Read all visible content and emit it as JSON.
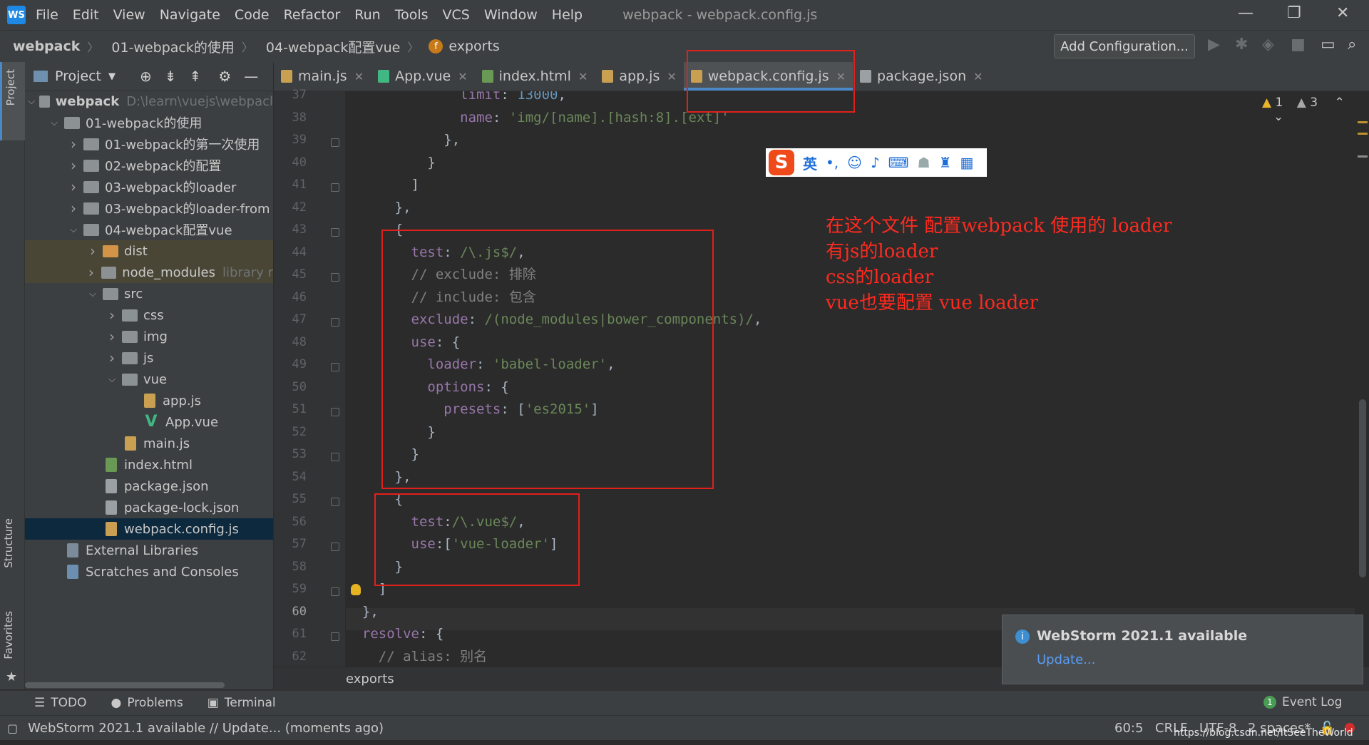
{
  "app": {
    "title": "webpack - webpack.config.js",
    "logo": "WS",
    "menu": [
      "File",
      "Edit",
      "View",
      "Navigate",
      "Code",
      "Refactor",
      "Run",
      "Tools",
      "VCS",
      "Window",
      "Help"
    ]
  },
  "navbar": {
    "crumbs": [
      "webpack",
      "01-webpack的使用",
      "04-webpack配置vue"
    ],
    "symbol_badge": "f",
    "symbol": "exports",
    "add_configuration": "Add Configuration..."
  },
  "left_strip": {
    "project": "Project",
    "structure": "Structure",
    "favorites": "Favorites"
  },
  "project_panel": {
    "header": "Project",
    "tree": [
      {
        "label": "webpack",
        "extra": "D:\\learn\\vuejs\\webpacl",
        "depth": 0,
        "type": "folder",
        "arrow": "open",
        "bold": true
      },
      {
        "label": "01-webpack的使用",
        "depth": 1,
        "type": "folder",
        "arrow": "open"
      },
      {
        "label": "01-webpack的第一次使用",
        "depth": 2,
        "type": "folder",
        "arrow": "closed"
      },
      {
        "label": "02-webpack的配置",
        "depth": 2,
        "type": "folder",
        "arrow": "closed"
      },
      {
        "label": "03-webpack的loader",
        "depth": 2,
        "type": "folder",
        "arrow": "closed"
      },
      {
        "label": "03-webpack的loader-from",
        "depth": 2,
        "type": "folder",
        "arrow": "closed"
      },
      {
        "label": "04-webpack配置vue",
        "depth": 2,
        "type": "folder",
        "arrow": "open"
      },
      {
        "label": "dist",
        "depth": 3,
        "type": "folder-orange",
        "arrow": "closed",
        "excluded": true
      },
      {
        "label": "node_modules",
        "extra": "library r",
        "depth": 3,
        "type": "folder",
        "arrow": "closed",
        "excluded": true
      },
      {
        "label": "src",
        "depth": 3,
        "type": "folder",
        "arrow": "open"
      },
      {
        "label": "css",
        "depth": 4,
        "type": "folder",
        "arrow": "closed"
      },
      {
        "label": "img",
        "depth": 4,
        "type": "folder",
        "arrow": "closed"
      },
      {
        "label": "js",
        "depth": 4,
        "type": "folder",
        "arrow": "closed"
      },
      {
        "label": "vue",
        "depth": 4,
        "type": "folder",
        "arrow": "open"
      },
      {
        "label": "app.js",
        "depth": 5,
        "type": "js"
      },
      {
        "label": "App.vue",
        "depth": 5,
        "type": "vue"
      },
      {
        "label": "main.js",
        "depth": 4,
        "type": "js"
      },
      {
        "label": "index.html",
        "depth": 3,
        "type": "html"
      },
      {
        "label": "package.json",
        "depth": 3,
        "type": "json"
      },
      {
        "label": "package-lock.json",
        "depth": 3,
        "type": "json"
      },
      {
        "label": "webpack.config.js",
        "depth": 3,
        "type": "js",
        "selected": true
      },
      {
        "label": "External Libraries",
        "depth": 1,
        "type": "lib"
      },
      {
        "label": "Scratches and Consoles",
        "depth": 1,
        "type": "scratch"
      }
    ]
  },
  "tabs": [
    {
      "label": "main.js",
      "icon": "js"
    },
    {
      "label": "App.vue",
      "icon": "vue"
    },
    {
      "label": "index.html",
      "icon": "html"
    },
    {
      "label": "app.js",
      "icon": "js"
    },
    {
      "label": "webpack.config.js",
      "icon": "js",
      "active": true
    },
    {
      "label": "package.json",
      "icon": "json"
    }
  ],
  "editor": {
    "line_numbers": [
      "37",
      "38",
      "39",
      "40",
      "41",
      "42",
      "43",
      "44",
      "45",
      "46",
      "47",
      "48",
      "49",
      "50",
      "51",
      "52",
      "53",
      "54",
      "55",
      "56",
      "57",
      "58",
      "59",
      "60",
      "61",
      "62"
    ],
    "current_line": "60",
    "warnings_a": "1",
    "warnings_b": "3",
    "breadcrumb": "exports",
    "lines": [
      [
        {
          "t": "              "
        },
        {
          "t": "limit",
          "c": "p"
        },
        {
          "t": ": "
        },
        {
          "t": "13000",
          "c": "n"
        },
        {
          "t": ","
        }
      ],
      [
        {
          "t": "              "
        },
        {
          "t": "name",
          "c": "p"
        },
        {
          "t": ": "
        },
        {
          "t": "'img/[name].[hash:8].[ext]'",
          "c": "s"
        }
      ],
      [
        {
          "t": "            },"
        }
      ],
      [
        {
          "t": "          }"
        }
      ],
      [
        {
          "t": "        ]"
        }
      ],
      [
        {
          "t": "      },"
        }
      ],
      [
        {
          "t": "      {"
        }
      ],
      [
        {
          "t": "        "
        },
        {
          "t": "test",
          "c": "p"
        },
        {
          "t": ": "
        },
        {
          "t": "/\\.js$/",
          "c": "s"
        },
        {
          "t": ","
        }
      ],
      [
        {
          "t": "        // exclude: 排除",
          "c": "c"
        }
      ],
      [
        {
          "t": "        // include: 包含",
          "c": "c"
        }
      ],
      [
        {
          "t": "        "
        },
        {
          "t": "exclude",
          "c": "p"
        },
        {
          "t": ": "
        },
        {
          "t": "/(node_modules|bower_components)/",
          "c": "s"
        },
        {
          "t": ","
        }
      ],
      [
        {
          "t": "        "
        },
        {
          "t": "use",
          "c": "p"
        },
        {
          "t": ": {"
        }
      ],
      [
        {
          "t": "          "
        },
        {
          "t": "loader",
          "c": "p"
        },
        {
          "t": ": "
        },
        {
          "t": "'babel-loader'",
          "c": "s"
        },
        {
          "t": ","
        }
      ],
      [
        {
          "t": "          "
        },
        {
          "t": "options",
          "c": "p"
        },
        {
          "t": ": {"
        }
      ],
      [
        {
          "t": "            "
        },
        {
          "t": "presets",
          "c": "p"
        },
        {
          "t": ": ["
        },
        {
          "t": "'es2015'",
          "c": "s"
        },
        {
          "t": "]"
        }
      ],
      [
        {
          "t": "          }"
        }
      ],
      [
        {
          "t": "        }"
        }
      ],
      [
        {
          "t": "      },"
        }
      ],
      [
        {
          "t": "      {"
        }
      ],
      [
        {
          "t": "        "
        },
        {
          "t": "test",
          "c": "p"
        },
        {
          "t": ":"
        },
        {
          "t": "/\\.vue$/",
          "c": "s"
        },
        {
          "t": ","
        }
      ],
      [
        {
          "t": "        "
        },
        {
          "t": "use",
          "c": "p"
        },
        {
          "t": ":["
        },
        {
          "t": "'vue-loader'",
          "c": "s"
        },
        {
          "t": "]"
        }
      ],
      [
        {
          "t": "      }"
        }
      ],
      [
        {
          "t": "    ]"
        }
      ],
      [
        {
          "t": "  },"
        }
      ],
      [
        {
          "t": "  "
        },
        {
          "t": "resolve",
          "c": "p"
        },
        {
          "t": ": {"
        }
      ],
      [
        {
          "t": "    // alias: 别名",
          "c": "c"
        }
      ]
    ]
  },
  "annotations": [
    "在这个文件  配置webpack 使用的 loader",
    "有js的loader",
    "css的loader",
    "vue也要配置  vue  loader"
  ],
  "ime": {
    "logo": "S",
    "lang": "英",
    "punct": "•,",
    "icons": [
      "smile-icon",
      "mic-icon",
      "keyboard-icon",
      "user-icon",
      "shirt-icon",
      "grid-icon"
    ]
  },
  "notification": {
    "title": "WebStorm 2021.1 available",
    "link": "Update..."
  },
  "bottom_tools": [
    "TODO",
    "Problems",
    "Terminal"
  ],
  "event_log": {
    "badge": "1",
    "label": "Event Log"
  },
  "status": {
    "message": "WebStorm 2021.1 available // Update... (moments ago)",
    "position": "60:5",
    "line_sep": "CRLF",
    "encoding": "UTF-8",
    "indent": "2 spaces*",
    "watermark": "https://blog.csdn.net/ItSeeTheWorld"
  },
  "colors": {
    "accent": "#4a88c7",
    "annotation_red": "#ff2a1f",
    "selection": "#0d293e"
  }
}
